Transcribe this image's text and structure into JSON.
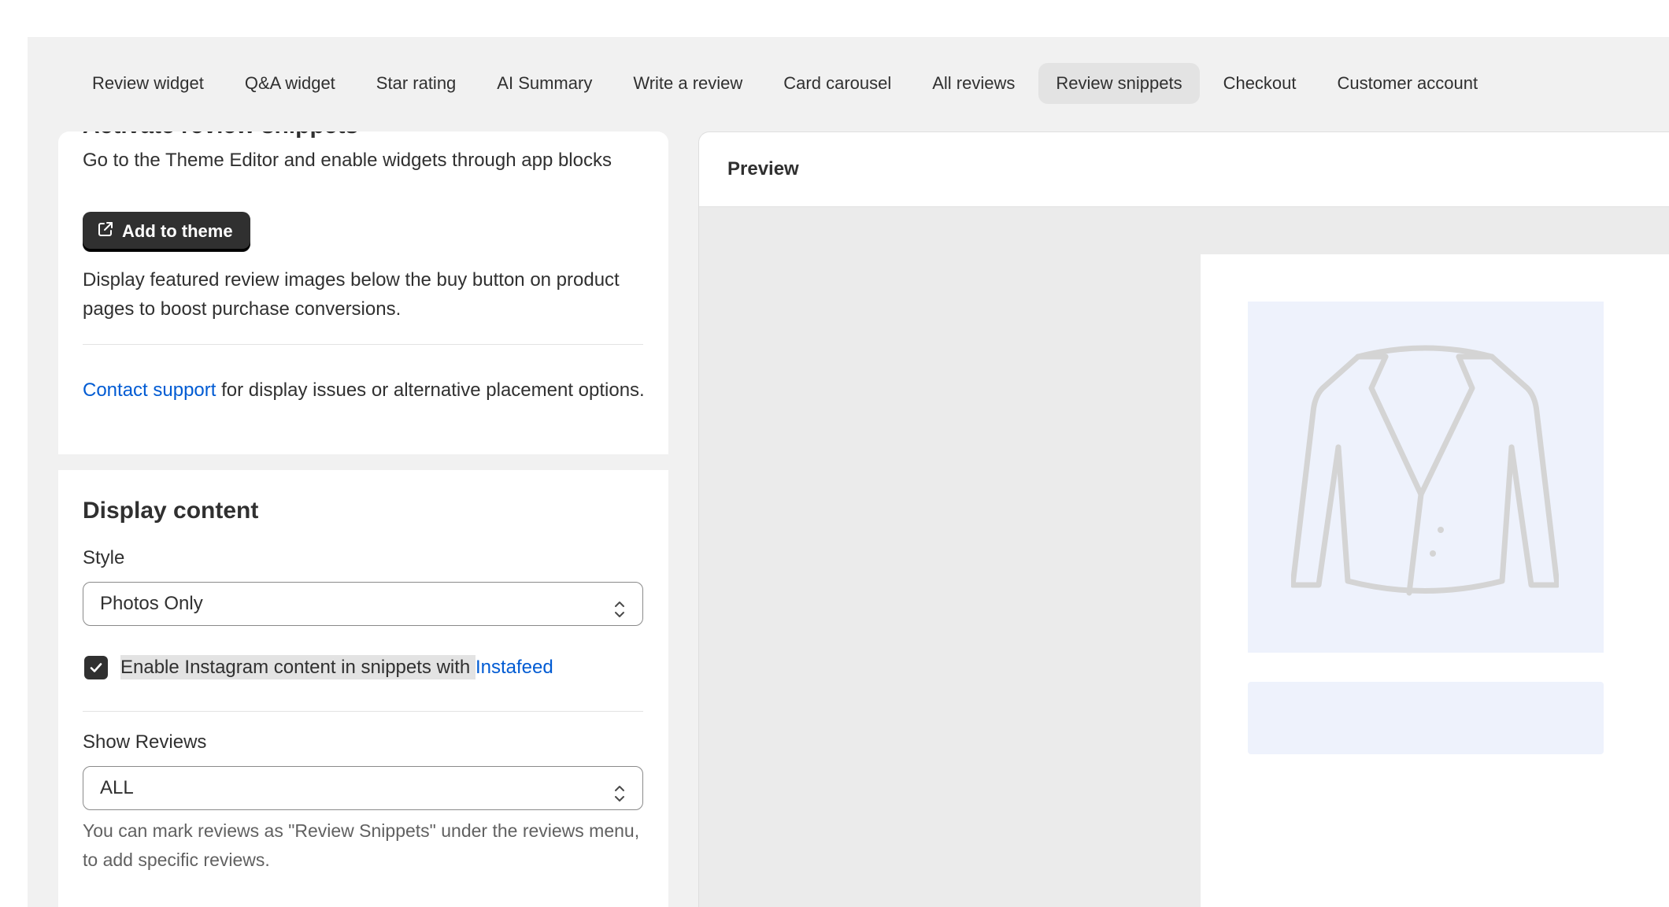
{
  "tabs": [
    {
      "label": "Review widget"
    },
    {
      "label": "Q&A widget"
    },
    {
      "label": "Star rating"
    },
    {
      "label": "AI Summary"
    },
    {
      "label": "Write a review"
    },
    {
      "label": "Card carousel"
    },
    {
      "label": "All reviews"
    },
    {
      "label": "Review snippets",
      "active": true
    },
    {
      "label": "Checkout"
    },
    {
      "label": "Customer account"
    }
  ],
  "activate": {
    "title": "Activate review snippets",
    "instruction": "Go to the Theme Editor and enable widgets through app blocks",
    "add_button": "Add to theme",
    "description": "Display featured review images below the buy button on product pages to boost purchase conversions.",
    "support_link": "Contact support",
    "support_rest": " for display issues or alternative placement options."
  },
  "display_content": {
    "heading": "Display content",
    "style_label": "Style",
    "style_value": "Photos Only",
    "instagram_label": "Enable Instagram content in snippets with ",
    "instagram_link": "Instafeed",
    "instagram_checked": true,
    "show_reviews_label": "Show Reviews",
    "show_reviews_value": "ALL",
    "help_text": "You can mark reviews as \"Review Snippets\" under the reviews menu, to add specific reviews."
  },
  "preview": {
    "title": "Preview"
  },
  "colors": {
    "accent_link": "#005bd3",
    "primary_button": "#303030",
    "placeholder_bg": "#eef2fc"
  }
}
